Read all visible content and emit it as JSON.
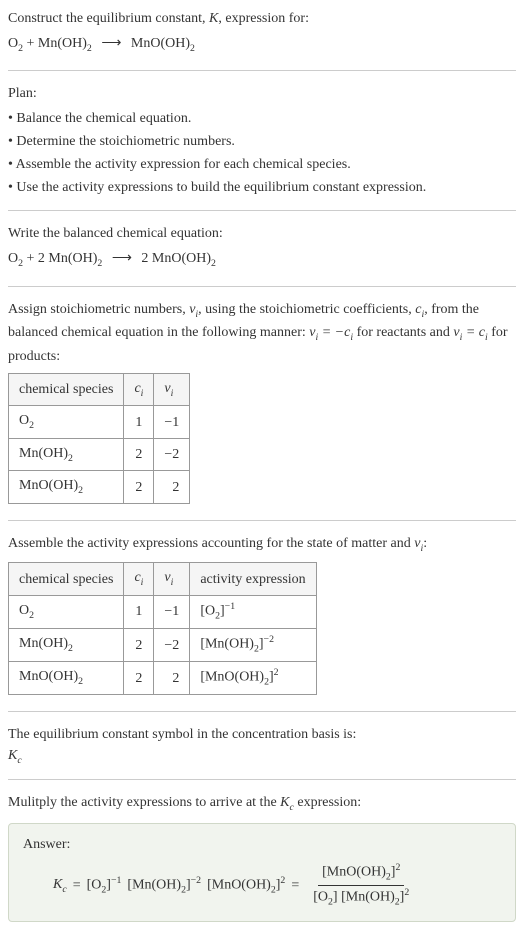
{
  "title_line1": "Construct the equilibrium constant, K, expression for:",
  "title_equation_lhs": "O₂ + Mn(OH)₂",
  "title_equation_arrow": "⟶",
  "title_equation_rhs": "MnO(OH)₂",
  "plan_header": "Plan:",
  "plan_items": [
    "• Balance the chemical equation.",
    "• Determine the stoichiometric numbers.",
    "• Assemble the activity expression for each chemical species.",
    "• Use the activity expressions to build the equilibrium constant expression."
  ],
  "balanced_header": "Write the balanced chemical equation:",
  "balanced_lhs": "O₂ + 2 Mn(OH)₂",
  "balanced_arrow": "⟶",
  "balanced_rhs": "2 MnO(OH)₂",
  "stoich_text_1": "Assign stoichiometric numbers, ",
  "stoich_nu": "νᵢ",
  "stoich_text_2": ", using the stoichiometric coefficients, ",
  "stoich_c": "cᵢ",
  "stoich_text_3": ", from the balanced chemical equation in the following manner: ",
  "stoich_formula_1": "νᵢ = −cᵢ",
  "stoich_text_4": " for reactants and ",
  "stoich_formula_2": "νᵢ = cᵢ",
  "stoich_text_5": " for products:",
  "table1": {
    "headers": [
      "chemical species",
      "cᵢ",
      "νᵢ"
    ],
    "rows": [
      [
        "O₂",
        "1",
        "−1"
      ],
      [
        "Mn(OH)₂",
        "2",
        "−2"
      ],
      [
        "MnO(OH)₂",
        "2",
        "2"
      ]
    ]
  },
  "activity_header_1": "Assemble the activity expressions accounting for the state of matter and ",
  "activity_header_nu": "νᵢ",
  "activity_header_2": ":",
  "table2": {
    "headers": [
      "chemical species",
      "cᵢ",
      "νᵢ",
      "activity expression"
    ],
    "rows": [
      [
        "O₂",
        "1",
        "−1",
        "[O₂]⁻¹"
      ],
      [
        "Mn(OH)₂",
        "2",
        "−2",
        "[Mn(OH)₂]⁻²"
      ],
      [
        "MnO(OH)₂",
        "2",
        "2",
        "[MnO(OH)₂]²"
      ]
    ]
  },
  "eq_symbol_text": "The equilibrium constant symbol in the concentration basis is:",
  "eq_symbol": "K_c",
  "multiply_text_1": "Mulitply the activity expressions to arrive at the ",
  "multiply_kc": "K_c",
  "multiply_text_2": " expression:",
  "answer_label": "Answer:",
  "answer_kc": "K_c",
  "answer_eq": " = ",
  "answer_term1": "[O₂]⁻¹",
  "answer_term2": "[Mn(OH)₂]⁻²",
  "answer_term3": "[MnO(OH)₂]²",
  "answer_frac_num": "[MnO(OH)₂]²",
  "answer_frac_den_1": "[O₂]",
  "answer_frac_den_2": "[Mn(OH)₂]²"
}
